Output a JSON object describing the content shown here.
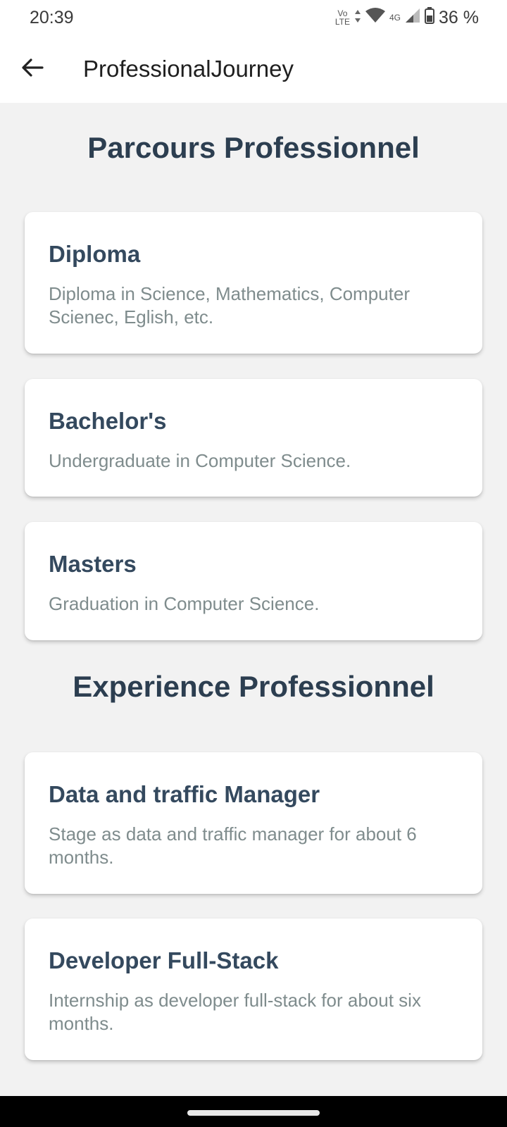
{
  "status_bar": {
    "time": "20:39",
    "volte_top": "Vo",
    "volte_bottom": "LTE",
    "network": "4G",
    "battery": "36 %"
  },
  "app_bar": {
    "back_icon": "arrow-left-icon",
    "title": "ProfessionalJourney"
  },
  "sections": [
    {
      "title": "Parcours Professionnel",
      "cards": [
        {
          "title": "Diploma",
          "description": "Diploma in Science, Mathematics, Computer Scienec, Eglish, etc."
        },
        {
          "title": "Bachelor's",
          "description": "Undergraduate in Computer Science."
        },
        {
          "title": "Masters",
          "description": "Graduation in Computer Science."
        }
      ]
    },
    {
      "title": "Experience Professionnel",
      "cards": [
        {
          "title": "Data and traffic Manager",
          "description": "Stage as data and traffic manager for about 6 months."
        },
        {
          "title": "Developer Full-Stack",
          "description": "Internship as developer full-stack for about six months."
        }
      ]
    }
  ]
}
